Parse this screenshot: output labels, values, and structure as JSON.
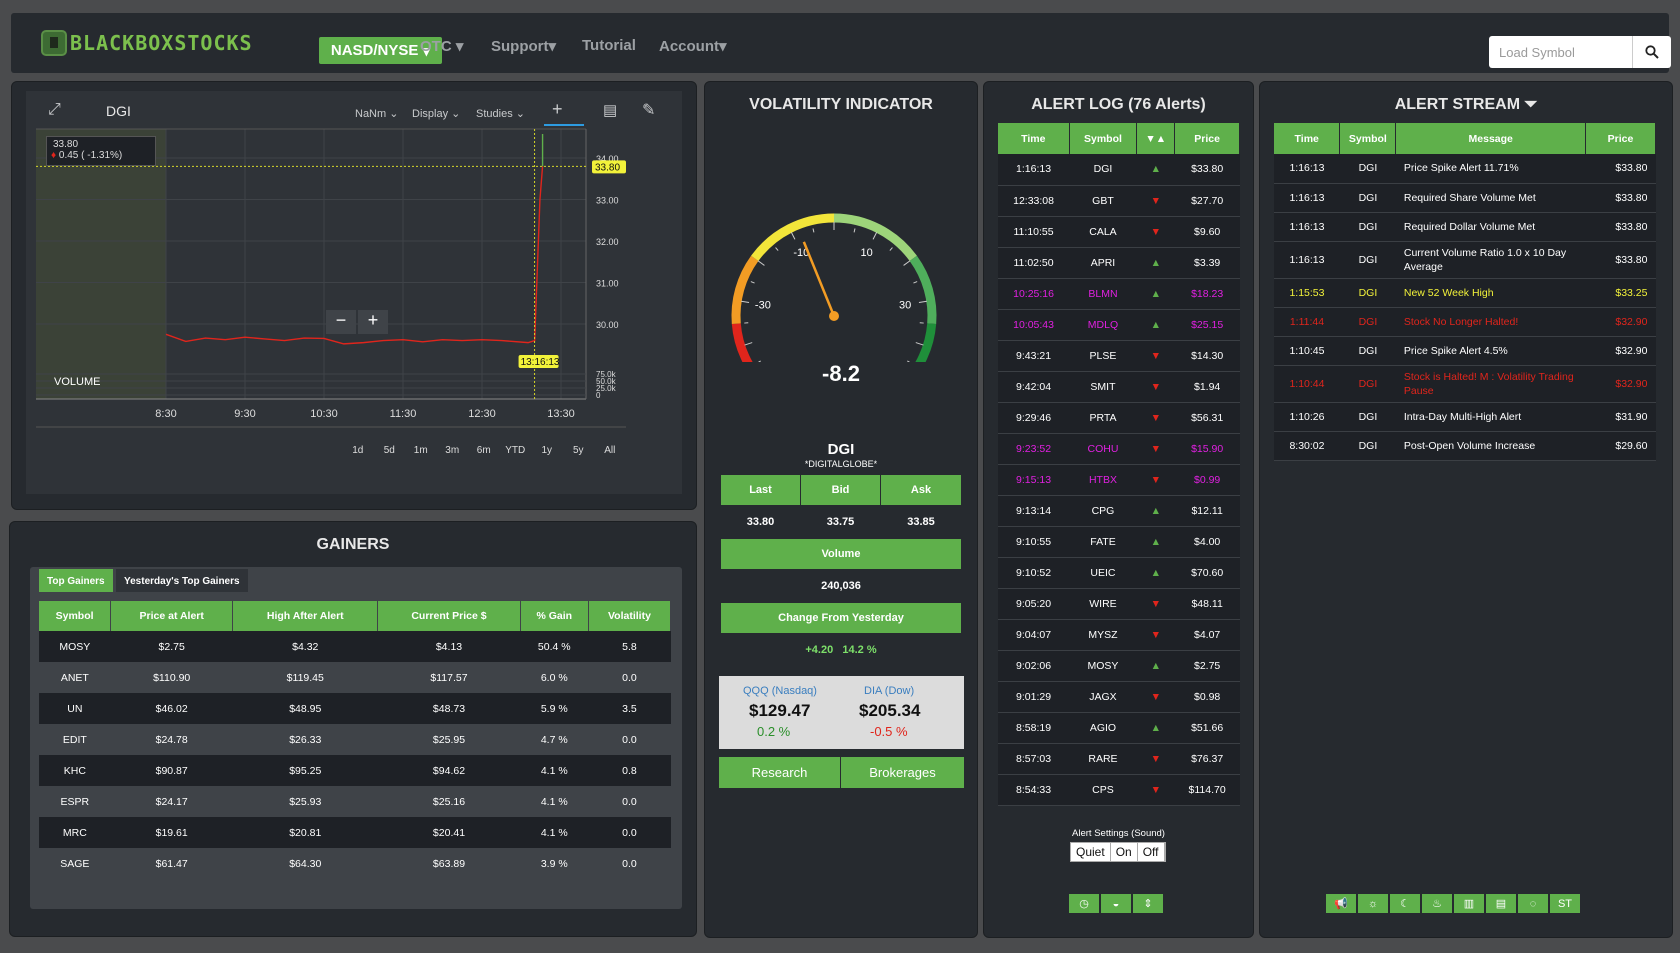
{
  "nav": {
    "logo": "BLACKBOXSTOCKS",
    "market_button": "NASD/NYSE",
    "items": [
      "OTC",
      "Support",
      "Tutorial",
      "Account"
    ],
    "search_placeholder": "Load Symbol"
  },
  "chart": {
    "symbol": "DGI",
    "toolbar": [
      "NaNm",
      "Display",
      "Studies"
    ],
    "quote_price": "33.80",
    "quote_change": "0.45 ( -1.31%)",
    "price_flag": "33.80",
    "crosshair_time": "13:16:13",
    "volume_label": "VOLUME",
    "y_ticks": [
      "34.00",
      "33.00",
      "32.00",
      "31.00",
      "30.00"
    ],
    "vol_ticks": [
      "75.0k",
      "50.0k",
      "25.0k",
      "0"
    ],
    "x_ticks": [
      "8:30",
      "9:30",
      "10:30",
      "11:30",
      "12:30",
      "13:30"
    ],
    "ranges": [
      "1d",
      "5d",
      "1m",
      "3m",
      "6m",
      "YTD",
      "1y",
      "5y",
      "All"
    ],
    "zoom_out": "−",
    "zoom_in": "+"
  },
  "chart_data": {
    "type": "line",
    "x_range": [
      "8:30",
      "13:45"
    ],
    "y_range": [
      29.3,
      34.7
    ],
    "series": [
      {
        "x": [
          "8:30",
          "8:45",
          "9:00",
          "9:15",
          "9:30",
          "9:45",
          "10:00",
          "10:15",
          "10:30",
          "10:45",
          "11:00",
          "11:15",
          "11:30",
          "11:45",
          "12:00",
          "12:15",
          "12:30",
          "12:45",
          "13:05",
          "13:10",
          "13:14",
          "13:16"
        ],
        "values": [
          29.75,
          29.58,
          29.66,
          29.62,
          29.68,
          29.64,
          29.6,
          29.66,
          29.65,
          29.52,
          29.55,
          29.6,
          29.62,
          29.57,
          29.62,
          29.6,
          29.62,
          29.6,
          29.55,
          29.6,
          33.0,
          33.8
        ]
      }
    ],
    "color": "#e0251c"
  },
  "gainers": {
    "title": "GAINERS",
    "tabs": [
      "Top Gainers",
      "Yesterday's Top Gainers"
    ],
    "columns": [
      "Symbol",
      "Price at Alert",
      "High After Alert",
      "Current Price $",
      "% Gain",
      "Volatility"
    ],
    "rows": [
      [
        "MOSY",
        "$2.75",
        "$4.32",
        "$4.13",
        "50.4 %",
        "5.8"
      ],
      [
        "ANET",
        "$110.90",
        "$119.45",
        "$117.57",
        "6.0 %",
        "0.0"
      ],
      [
        "UN",
        "$46.02",
        "$48.95",
        "$48.73",
        "5.9 %",
        "3.5"
      ],
      [
        "EDIT",
        "$24.78",
        "$26.33",
        "$25.95",
        "4.7 %",
        "0.0"
      ],
      [
        "KHC",
        "$90.87",
        "$95.25",
        "$94.62",
        "4.1 %",
        "0.8"
      ],
      [
        "ESPR",
        "$24.17",
        "$25.93",
        "$25.16",
        "4.1 %",
        "0.0"
      ],
      [
        "MRC",
        "$19.61",
        "$20.81",
        "$20.41",
        "4.1 %",
        "0.0"
      ],
      [
        "SAGE",
        "$61.47",
        "$64.30",
        "$63.89",
        "3.9 %",
        "0.0"
      ]
    ]
  },
  "volatility": {
    "title": "VOLATILITY INDICATOR",
    "gauge_value": "-8.2",
    "gauge_ticks": [
      "-50",
      "-30",
      "-10",
      "10",
      "30",
      "50"
    ],
    "symbol": "DGI",
    "company": "*DIGITALGLOBE*",
    "last_label": "Last",
    "bid_label": "Bid",
    "ask_label": "Ask",
    "last": "33.80",
    "bid": "33.75",
    "ask": "33.85",
    "volume_label": "Volume",
    "volume": "240,036",
    "change_label": "Change From Yesterday",
    "change_abs": "+4.20",
    "change_pct": "14.2 %",
    "qqq_label": "QQQ (Nasdaq)",
    "qqq_price": "$129.47",
    "qqq_pct": "0.2 %",
    "dia_label": "DIA (Dow)",
    "dia_price": "$205.34",
    "dia_pct": "-0.5 %",
    "research": "Research",
    "brokerages": "Brokerages"
  },
  "alert_log": {
    "title": "ALERT LOG (76 Alerts)",
    "columns": [
      "Time",
      "Symbol",
      "▼▲",
      "Price"
    ],
    "rows": [
      {
        "time": "1:16:13",
        "sym": "DGI",
        "dir": "up",
        "price": "$33.80",
        "c": "w"
      },
      {
        "time": "12:33:08",
        "sym": "GBT",
        "dir": "dn",
        "price": "$27.70",
        "c": "w"
      },
      {
        "time": "11:10:55",
        "sym": "CALA",
        "dir": "dn",
        "price": "$9.60",
        "c": "w"
      },
      {
        "time": "11:02:50",
        "sym": "APRI",
        "dir": "up",
        "price": "$3.39",
        "c": "w"
      },
      {
        "time": "10:25:16",
        "sym": "BLMN",
        "dir": "up",
        "price": "$18.23",
        "c": "m"
      },
      {
        "time": "10:05:43",
        "sym": "MDLQ",
        "dir": "up",
        "price": "$25.15",
        "c": "m"
      },
      {
        "time": "9:43:21",
        "sym": "PLSE",
        "dir": "dn",
        "price": "$14.30",
        "c": "w"
      },
      {
        "time": "9:42:04",
        "sym": "SMIT",
        "dir": "dn",
        "price": "$1.94",
        "c": "w"
      },
      {
        "time": "9:29:46",
        "sym": "PRTA",
        "dir": "dn",
        "price": "$56.31",
        "c": "w"
      },
      {
        "time": "9:23:52",
        "sym": "COHU",
        "dir": "dn",
        "price": "$15.90",
        "c": "m"
      },
      {
        "time": "9:15:13",
        "sym": "HTBX",
        "dir": "dn",
        "price": "$0.99",
        "c": "m"
      },
      {
        "time": "9:13:14",
        "sym": "CPG",
        "dir": "up",
        "price": "$12.11",
        "c": "w"
      },
      {
        "time": "9:10:55",
        "sym": "FATE",
        "dir": "up",
        "price": "$4.00",
        "c": "w"
      },
      {
        "time": "9:10:52",
        "sym": "UEIC",
        "dir": "up",
        "price": "$70.60",
        "c": "w"
      },
      {
        "time": "9:05:20",
        "sym": "WIRE",
        "dir": "dn",
        "price": "$48.11",
        "c": "w"
      },
      {
        "time": "9:04:07",
        "sym": "MYSZ",
        "dir": "dn",
        "price": "$4.07",
        "c": "w"
      },
      {
        "time": "9:02:06",
        "sym": "MOSY",
        "dir": "up",
        "price": "$2.75",
        "c": "w"
      },
      {
        "time": "9:01:29",
        "sym": "JAGX",
        "dir": "dn",
        "price": "$0.98",
        "c": "w"
      },
      {
        "time": "8:58:19",
        "sym": "AGIO",
        "dir": "up",
        "price": "$51.66",
        "c": "w"
      },
      {
        "time": "8:57:03",
        "sym": "RARE",
        "dir": "dn",
        "price": "$76.37",
        "c": "w"
      },
      {
        "time": "8:54:33",
        "sym": "CPS",
        "dir": "dn",
        "price": "$114.70",
        "c": "w"
      }
    ],
    "settings_label": "Alert Settings (Sound)",
    "sound_options": [
      "Quiet",
      "On",
      "Off"
    ]
  },
  "alert_stream": {
    "title": "ALERT STREAM",
    "columns": [
      "Time",
      "Symbol",
      "Message",
      "Price"
    ],
    "rows": [
      {
        "time": "1:16:13",
        "sym": "DGI",
        "msg": "Price Spike Alert 11.71%",
        "price": "$33.80",
        "c": "w"
      },
      {
        "time": "1:16:13",
        "sym": "DGI",
        "msg": "Required Share Volume Met",
        "price": "$33.80",
        "c": "w"
      },
      {
        "time": "1:16:13",
        "sym": "DGI",
        "msg": "Required Dollar Volume Met",
        "price": "$33.80",
        "c": "w"
      },
      {
        "time": "1:16:13",
        "sym": "DGI",
        "msg": "Current Volume Ratio 1.0 x 10 Day Average",
        "price": "$33.80",
        "c": "w"
      },
      {
        "time": "1:15:53",
        "sym": "DGI",
        "msg": "New 52 Week High",
        "price": "$33.25",
        "c": "y"
      },
      {
        "time": "1:11:44",
        "sym": "DGI",
        "msg": "Stock No Longer Halted!",
        "price": "$32.90",
        "c": "r"
      },
      {
        "time": "1:10:45",
        "sym": "DGI",
        "msg": "Price Spike Alert 4.5%",
        "price": "$32.90",
        "c": "w"
      },
      {
        "time": "1:10:44",
        "sym": "DGI",
        "msg": "Stock is Halted! M : Volatility Trading Pause",
        "price": "$32.90",
        "c": "r"
      },
      {
        "time": "1:10:26",
        "sym": "DGI",
        "msg": "Intra-Day Multi-High Alert",
        "price": "$31.90",
        "c": "w"
      },
      {
        "time": "8:30:02",
        "sym": "DGI",
        "msg": "Post-Open Volume Increase",
        "price": "$29.60",
        "c": "w"
      }
    ]
  },
  "colors": {
    "green": "#5fb04b",
    "red": "#e0251c",
    "magenta": "#e020e0",
    "yellow": "#f2f23a"
  }
}
